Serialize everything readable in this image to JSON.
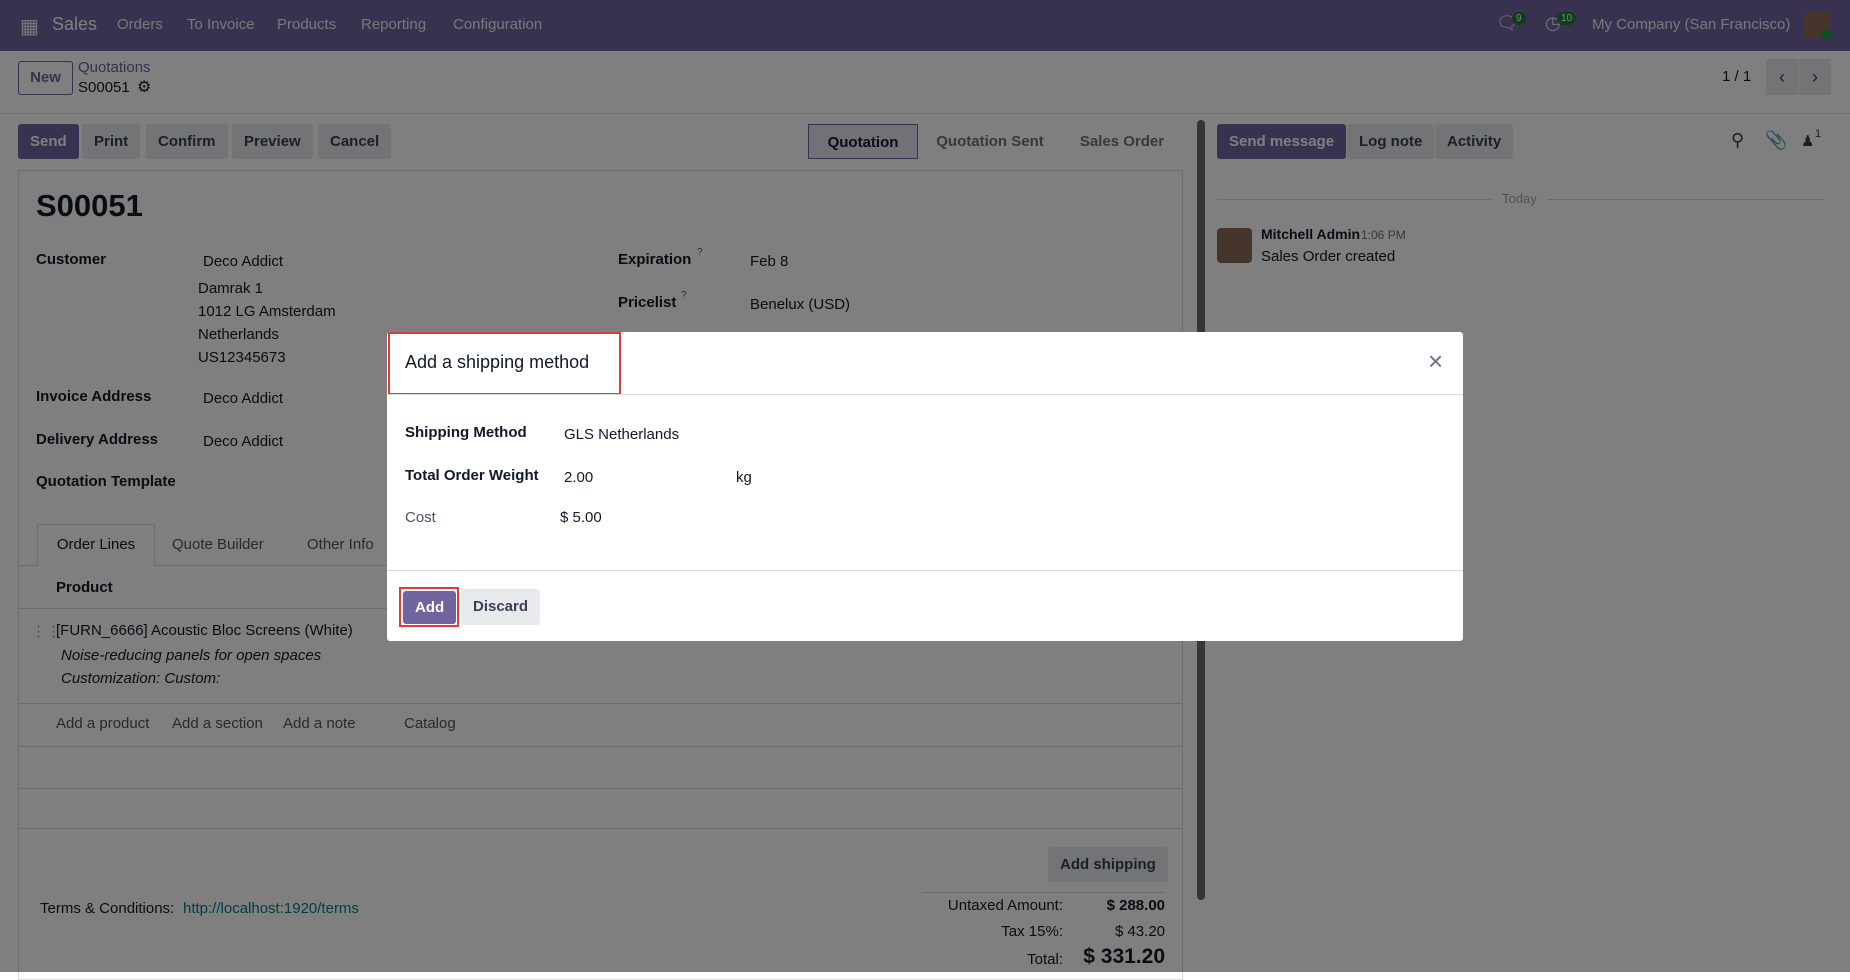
{
  "navbar": {
    "app": "Sales",
    "menu": [
      "Orders",
      "To Invoice",
      "Products",
      "Reporting",
      "Configuration"
    ],
    "messages_count": "9",
    "activities_count": "10",
    "company": "My Company (San Francisco)",
    "brand_color": "#71639e"
  },
  "control_panel": {
    "new_label": "New",
    "breadcrumb_parent": "Quotations",
    "breadcrumb_current": "S00051",
    "pager": "1 / 1"
  },
  "actions": {
    "send": "Send",
    "print": "Print",
    "confirm": "Confirm",
    "preview": "Preview",
    "cancel": "Cancel"
  },
  "status": {
    "steps": [
      "Quotation",
      "Quotation Sent",
      "Sales Order"
    ],
    "active": "Quotation"
  },
  "form": {
    "title": "S00051",
    "customer_label": "Customer",
    "customer": "Deco Addict",
    "address": [
      "Damrak 1",
      "1012 LG Amsterdam",
      "Netherlands",
      "US12345673"
    ],
    "invoice_label": "Invoice Address",
    "invoice": "Deco Addict",
    "delivery_label": "Delivery Address",
    "delivery": "Deco Addict",
    "template_label": "Quotation Template",
    "expiration_label": "Expiration",
    "expiration": "Feb 8",
    "pricelist_label": "Pricelist",
    "pricelist": "Benelux (USD)",
    "help_mark": "?",
    "tabs": [
      "Order Lines",
      "Quote Builder",
      "Other Info"
    ],
    "product_header": "Product",
    "line": {
      "name": "[FURN_6666] Acoustic Bloc Screens (White)",
      "desc1": "Noise-reducing panels for open spaces",
      "desc2": "Customization: Custom:"
    },
    "add_links": [
      "Add a product",
      "Add a section",
      "Add a note",
      "Catalog"
    ],
    "add_shipping": "Add shipping",
    "terms_label": "Terms & Conditions:",
    "terms_link": "http://localhost:1920/terms",
    "totals": {
      "untaxed_label": "Untaxed Amount:",
      "untaxed": "$ 288.00",
      "tax_label": "Tax 15%:",
      "tax": "$ 43.20",
      "total_label": "Total:",
      "total": "$ 331.20"
    }
  },
  "chatter": {
    "send_message": "Send message",
    "log_note": "Log note",
    "activity": "Activity",
    "followers": "1",
    "today": "Today",
    "author": "Mitchell Admin",
    "time": "1:06 PM",
    "message": "Sales Order created"
  },
  "dialog": {
    "title": "Add a shipping method",
    "method_label": "Shipping Method",
    "method": "GLS Netherlands",
    "weight_label": "Total Order Weight",
    "weight": "2.00",
    "weight_unit": "kg",
    "cost_label": "Cost",
    "cost": "$ 5.00",
    "add": "Add",
    "discard": "Discard"
  }
}
